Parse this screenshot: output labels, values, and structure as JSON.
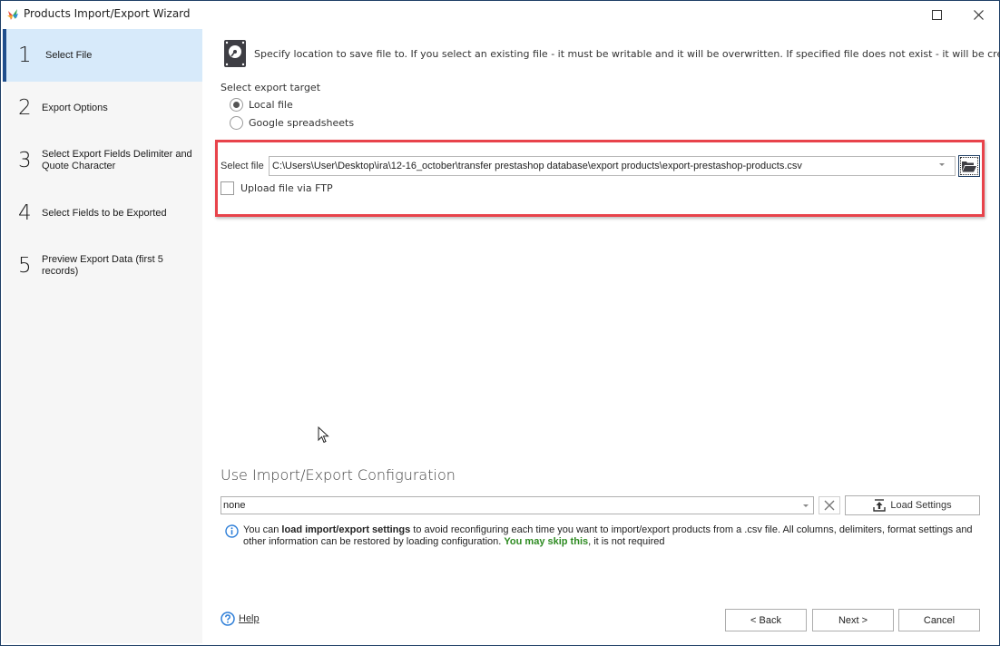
{
  "window": {
    "title": "Products Import/Export Wizard",
    "maximize_icon": "maximize-icon",
    "close_icon": "close-icon"
  },
  "sidebar": {
    "steps": [
      {
        "num": "1",
        "label": "Select File",
        "active": true
      },
      {
        "num": "2",
        "label": "Export Options",
        "active": false
      },
      {
        "num": "3",
        "label": "Select Export Fields Delimiter and Quote Character",
        "active": false
      },
      {
        "num": "4",
        "label": "Select Fields to be Exported",
        "active": false
      },
      {
        "num": "5",
        "label": "Preview Export Data (first 5 records)",
        "active": false
      }
    ]
  },
  "main": {
    "intro_icon": "hard-drive-icon",
    "intro_text": "Specify location to save file to. If you select an existing file - it must be writable and it will be overwritten. If specified file does not exist - it will be created.",
    "export_target": {
      "label": "Select export target",
      "options": [
        {
          "label": "Local file",
          "checked": true
        },
        {
          "label": "Google spreadsheets",
          "checked": false
        }
      ]
    },
    "select_file": {
      "label": "Select file",
      "value": "C:\\Users\\User\\Desktop\\ira\\12-16_october\\transfer prestashop database\\export products\\export-prestashop-products.csv",
      "browse_icon": "folder-open-icon"
    },
    "ftp": {
      "label": "Upload file via FTP",
      "checked": false
    },
    "highlight_color": "#e8434b"
  },
  "config": {
    "title": "Use Import/Export Configuration",
    "selected": "none",
    "clear_icon": "clear-icon",
    "load_button": "Load Settings",
    "info": {
      "prefix": "You can ",
      "bold": "load import/export settings",
      "middle": " to avoid reconfiguring each time you want to import/export products from a .csv file. All columns, delimiters, format settings and other information can be restored by loading configuration. ",
      "green": "You may skip this",
      "suffix": ", it is not required"
    },
    "green_color": "#2e8b22"
  },
  "footer": {
    "help": "Help",
    "back": "< Back",
    "next": "Next >",
    "cancel": "Cancel"
  }
}
